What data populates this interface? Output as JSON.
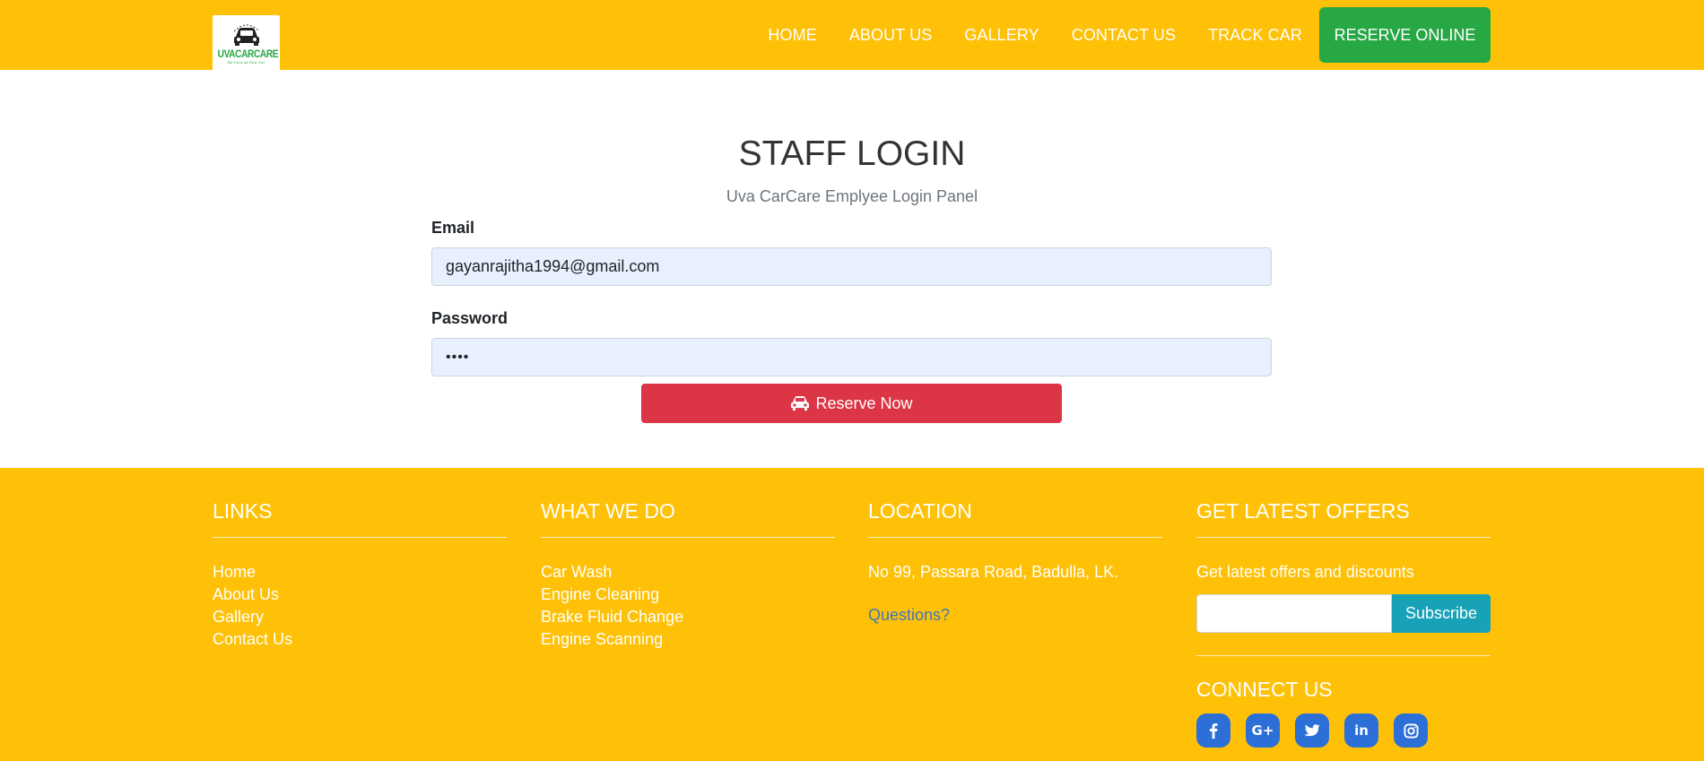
{
  "header": {
    "logo": {
      "brand_text": "UVACARCARE",
      "tagline": "We Care At Your Car"
    },
    "nav": [
      {
        "label": "HOME",
        "name": "nav-home"
      },
      {
        "label": "ABOUT US",
        "name": "nav-about-us"
      },
      {
        "label": "GALLERY",
        "name": "nav-gallery"
      },
      {
        "label": "CONTACT US",
        "name": "nav-contact-us"
      },
      {
        "label": "TRACK CAR",
        "name": "nav-track-car"
      }
    ],
    "reserve_label": "RESERVE ONLINE"
  },
  "login": {
    "title": "STAFF LOGIN",
    "subtitle": "Uva CarCare Emplyee Login Panel",
    "email_label": "Email",
    "email_value": "gayanrajitha1994@gmail.com",
    "password_label": "Password",
    "password_value": "••••",
    "submit_icon": "car-icon",
    "submit_label": "Reserve Now"
  },
  "footer": {
    "links": {
      "title": "LINKS",
      "items": [
        "Home",
        "About Us",
        "Gallery",
        "Contact Us"
      ]
    },
    "what_we_do": {
      "title": "WHAT WE DO",
      "items": [
        "Car Wash",
        "Engine Cleaning",
        "Brake Fluid Change",
        "Engine Scanning"
      ]
    },
    "location": {
      "title": "LOCATION",
      "address": "No 99, Passara Road, Badulla, LK.",
      "questions": "Questions?"
    },
    "offers": {
      "title": "GET LATEST OFFERS",
      "text": "Get latest offers and discounts",
      "subscribe_label": "Subscribe",
      "connect_title": "CONNECT US",
      "socials": [
        "facebook-icon",
        "google-plus-icon",
        "twitter-icon",
        "linkedin-icon",
        "instagram-icon"
      ]
    }
  },
  "colors": {
    "header_bg": "#ffc107",
    "reserve_btn": "#28a745",
    "submit_btn": "#dc3545",
    "subscribe_btn": "#17a2b8",
    "social_bg": "#2c6fd6",
    "input_bg": "#e8f0fe"
  }
}
